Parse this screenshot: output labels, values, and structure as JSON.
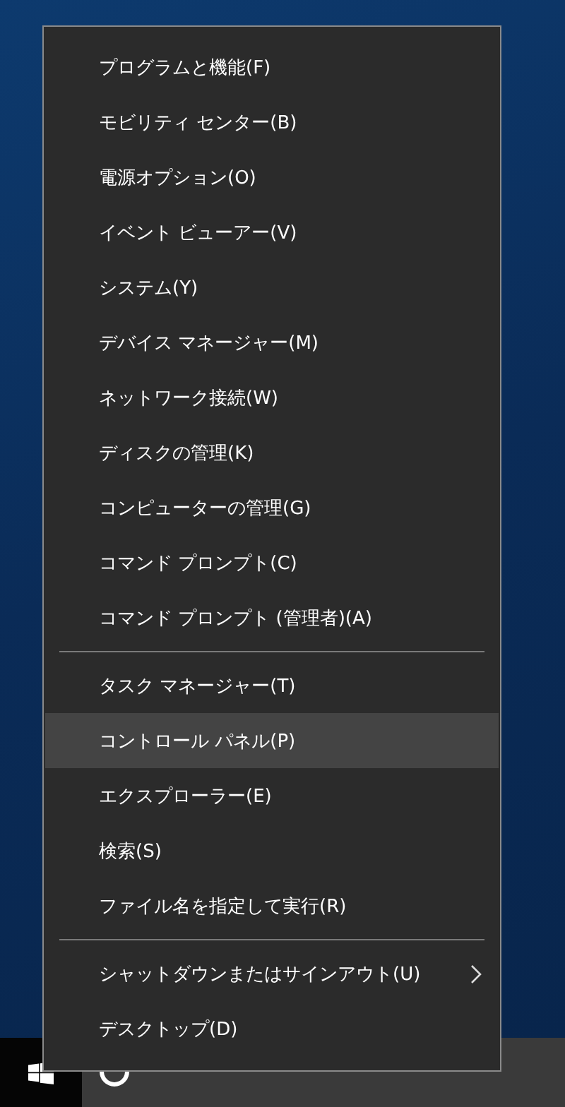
{
  "menu": {
    "sections": [
      {
        "items": [
          {
            "label": "プログラムと機能(F)",
            "selected": false,
            "submenu": false
          },
          {
            "label": "モビリティ センター(B)",
            "selected": false,
            "submenu": false
          },
          {
            "label": "電源オプション(O)",
            "selected": false,
            "submenu": false
          },
          {
            "label": "イベント ビューアー(V)",
            "selected": false,
            "submenu": false
          },
          {
            "label": "システム(Y)",
            "selected": false,
            "submenu": false
          },
          {
            "label": "デバイス マネージャー(M)",
            "selected": false,
            "submenu": false
          },
          {
            "label": "ネットワーク接続(W)",
            "selected": false,
            "submenu": false
          },
          {
            "label": "ディスクの管理(K)",
            "selected": false,
            "submenu": false
          },
          {
            "label": "コンピューターの管理(G)",
            "selected": false,
            "submenu": false
          },
          {
            "label": "コマンド プロンプト(C)",
            "selected": false,
            "submenu": false
          },
          {
            "label": "コマンド プロンプト (管理者)(A)",
            "selected": false,
            "submenu": false
          }
        ]
      },
      {
        "items": [
          {
            "label": "タスク マネージャー(T)",
            "selected": false,
            "submenu": false
          },
          {
            "label": "コントロール パネル(P)",
            "selected": true,
            "submenu": false
          },
          {
            "label": "エクスプローラー(E)",
            "selected": false,
            "submenu": false
          },
          {
            "label": "検索(S)",
            "selected": false,
            "submenu": false
          },
          {
            "label": "ファイル名を指定して実行(R)",
            "selected": false,
            "submenu": false
          }
        ]
      },
      {
        "items": [
          {
            "label": "シャットダウンまたはサインアウト(U)",
            "selected": false,
            "submenu": true
          },
          {
            "label": "デスクトップ(D)",
            "selected": false,
            "submenu": false
          }
        ]
      }
    ]
  }
}
